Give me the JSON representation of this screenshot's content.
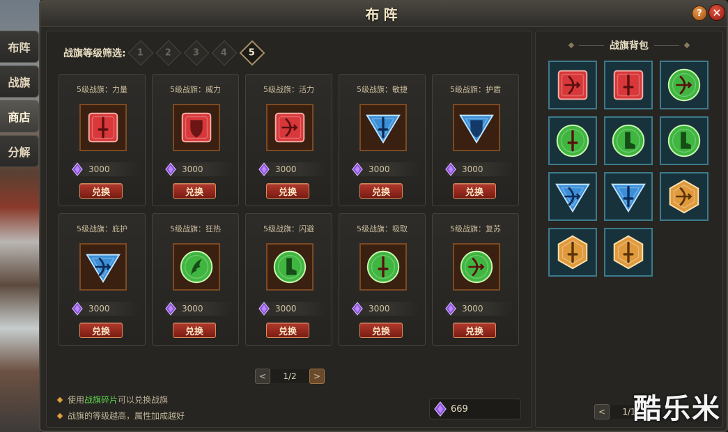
{
  "side_tabs": [
    {
      "label": "布阵",
      "active": false
    },
    {
      "label": "战旗",
      "active": false
    },
    {
      "label": "商店",
      "active": true
    },
    {
      "label": "分解",
      "active": false
    }
  ],
  "window": {
    "title": "布阵",
    "help_label": "?",
    "close_label": "✕"
  },
  "filter": {
    "label": "战旗等级筛选:",
    "levels": [
      "1",
      "2",
      "3",
      "4",
      "5"
    ],
    "selected": "5"
  },
  "shop_items": [
    {
      "name": "5级战旗：力量",
      "price": "3000",
      "button": "兑换",
      "shape": "square",
      "color": "red",
      "symbol": "sword"
    },
    {
      "name": "5级战旗：威力",
      "price": "3000",
      "button": "兑换",
      "shape": "square",
      "color": "red",
      "symbol": "shield"
    },
    {
      "name": "5级战旗：活力",
      "price": "3000",
      "button": "兑换",
      "shape": "square",
      "color": "red",
      "symbol": "bow"
    },
    {
      "name": "5级战旗：敏捷",
      "price": "3000",
      "button": "兑换",
      "shape": "triangle",
      "color": "blue",
      "symbol": "sword"
    },
    {
      "name": "5级战旗：护盾",
      "price": "3000",
      "button": "兑换",
      "shape": "triangle",
      "color": "blue",
      "symbol": "shield"
    },
    {
      "name": "5级战旗：庇护",
      "price": "3000",
      "button": "兑换",
      "shape": "triangle",
      "color": "blue",
      "symbol": "bow"
    },
    {
      "name": "5级战旗：狂热",
      "price": "3000",
      "button": "兑换",
      "shape": "circle",
      "color": "green",
      "symbol": "wing"
    },
    {
      "name": "5级战旗：闪避",
      "price": "3000",
      "button": "兑换",
      "shape": "circle",
      "color": "green",
      "symbol": "boot"
    },
    {
      "name": "5级战旗：吸取",
      "price": "3000",
      "button": "兑换",
      "shape": "circle",
      "color": "green",
      "symbol": "sword"
    },
    {
      "name": "5级战旗：复苏",
      "price": "3000",
      "button": "兑换",
      "shape": "circle",
      "color": "green",
      "symbol": "bow"
    }
  ],
  "pager": {
    "prev": "<",
    "next": ">",
    "text": "1/2"
  },
  "tips": [
    {
      "pre": "使用",
      "highlight": "战旗碎片",
      "post": "可以兑换战旗"
    },
    {
      "pre": "战旗的等级越高，属性加成越好",
      "highlight": "",
      "post": ""
    }
  ],
  "balance": "669",
  "bag": {
    "title": "战旗背包",
    "items": [
      {
        "shape": "square",
        "color": "red",
        "symbol": "bow"
      },
      {
        "shape": "square",
        "color": "red",
        "symbol": "sword"
      },
      {
        "shape": "circle",
        "color": "green",
        "symbol": "bow"
      },
      {
        "shape": "circle",
        "color": "green",
        "symbol": "sword"
      },
      {
        "shape": "circle",
        "color": "green",
        "symbol": "boot"
      },
      {
        "shape": "circle",
        "color": "green",
        "symbol": "boot"
      },
      {
        "shape": "triangle",
        "color": "blue",
        "symbol": "bow"
      },
      {
        "shape": "triangle",
        "color": "blue",
        "symbol": "sword"
      },
      {
        "shape": "hexagon",
        "color": "orange",
        "symbol": "bow"
      },
      {
        "shape": "hexagon",
        "color": "orange",
        "symbol": "sword"
      },
      {
        "shape": "hexagon",
        "color": "orange",
        "symbol": "sword"
      }
    ],
    "pager_text": "1/1",
    "prev": "<"
  },
  "watermark": "酷乐米",
  "colors": {
    "red": "#d8383a",
    "blue": "#3a8fd8",
    "green": "#3fb640",
    "orange": "#e09a3c",
    "gem": "#8b4fd6"
  }
}
